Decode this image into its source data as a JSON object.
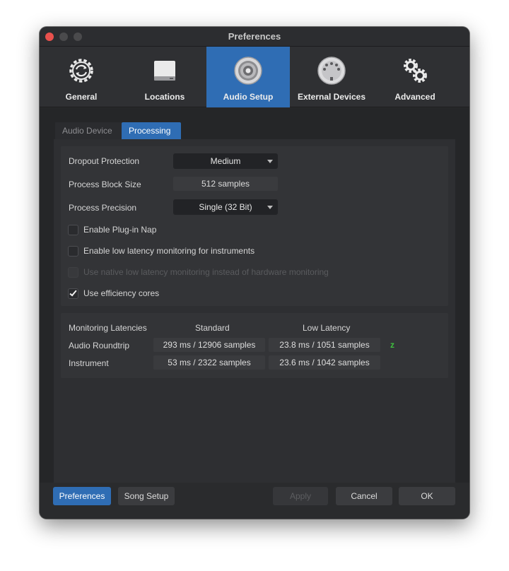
{
  "window": {
    "title": "Preferences"
  },
  "toolbar": {
    "items": [
      {
        "label": "General",
        "icon": "gear-sync-icon"
      },
      {
        "label": "Locations",
        "icon": "drive-icon"
      },
      {
        "label": "Audio Setup",
        "icon": "speaker-icon",
        "active": true
      },
      {
        "label": "External Devices",
        "icon": "midi-port-icon"
      },
      {
        "label": "Advanced",
        "icon": "gears-icon"
      }
    ]
  },
  "subtabs": {
    "audio_device": "Audio Device",
    "processing": "Processing"
  },
  "processing": {
    "dropout_protection": {
      "label": "Dropout Protection",
      "value": "Medium"
    },
    "process_block_size": {
      "label": "Process Block Size",
      "value": "512 samples"
    },
    "process_precision": {
      "label": "Process Precision",
      "value": "Single (32 Bit)"
    },
    "checkboxes": [
      {
        "label": "Enable Plug-in Nap",
        "checked": false,
        "enabled": true
      },
      {
        "label": "Enable low latency monitoring for instruments",
        "checked": false,
        "enabled": true
      },
      {
        "label": "Use native low latency monitoring instead of hardware monitoring",
        "checked": false,
        "enabled": false
      },
      {
        "label": "Use efficiency cores",
        "checked": true,
        "enabled": true
      }
    ]
  },
  "latencies": {
    "title": "Monitoring Latencies",
    "col_standard": "Standard",
    "col_low": "Low Latency",
    "rows": [
      {
        "label": "Audio Roundtrip",
        "standard": "293 ms / 12906 samples",
        "low": "23.8 ms / 1051 samples"
      },
      {
        "label": "Instrument",
        "standard": "53 ms / 2322 samples",
        "low": "23.6 ms / 1042 samples"
      }
    ],
    "link_icon": "z"
  },
  "footer": {
    "preferences": "Preferences",
    "song_setup": "Song Setup",
    "apply": "Apply",
    "cancel": "Cancel",
    "ok": "OK"
  },
  "colors": {
    "accent": "#2f6db4",
    "background": "#2a2b2d",
    "link_green": "#3fbf3f"
  }
}
